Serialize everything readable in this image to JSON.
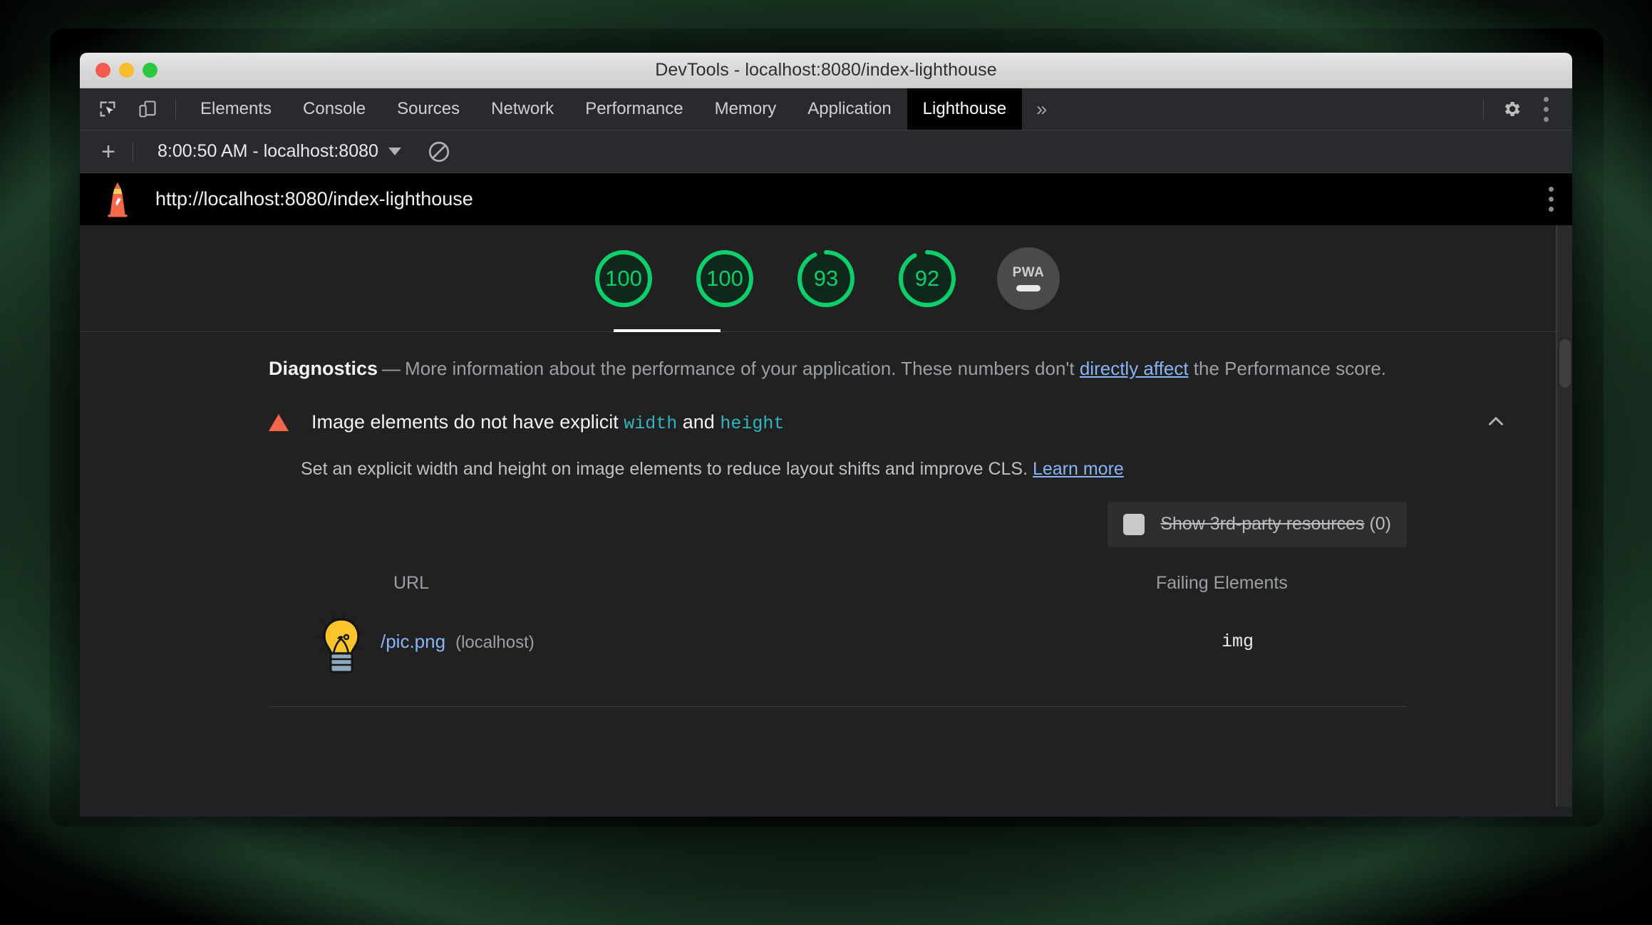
{
  "window": {
    "title": "DevTools - localhost:8080/index-lighthouse",
    "traffic_lights": [
      "close",
      "minimize",
      "maximize"
    ]
  },
  "devtools": {
    "tools": [
      {
        "name": "inspect-element-icon",
        "label": "Inspect element"
      },
      {
        "name": "device-toolbar-icon",
        "label": "Toggle device toolbar"
      }
    ],
    "tabs": [
      {
        "label": "Elements",
        "selected": false
      },
      {
        "label": "Console",
        "selected": false
      },
      {
        "label": "Sources",
        "selected": false
      },
      {
        "label": "Network",
        "selected": false
      },
      {
        "label": "Performance",
        "selected": false
      },
      {
        "label": "Memory",
        "selected": false
      },
      {
        "label": "Application",
        "selected": false
      },
      {
        "label": "Lighthouse",
        "selected": true
      }
    ],
    "more_tabs_label": "»",
    "settings_icon": "gear-icon",
    "menu_icon": "kebab-menu-icon"
  },
  "lighthouse_toolbar": {
    "add_label": "+",
    "run_selector_value": "8:00:50 AM - localhost:8080",
    "clear_icon": "clear-all-icon"
  },
  "report_header": {
    "logo_icon": "lighthouse-logo-icon",
    "url": "http://localhost:8080/index-lighthouse",
    "menu_icon": "kebab-menu-icon"
  },
  "scores": {
    "gauges": [
      {
        "value": "100",
        "pct": 100,
        "color": "#0cce6b",
        "selected": true
      },
      {
        "value": "100",
        "pct": 100,
        "color": "#0cce6b",
        "selected": false
      },
      {
        "value": "93",
        "pct": 93,
        "color": "#0cce6b",
        "selected": false
      },
      {
        "value": "92",
        "pct": 92,
        "color": "#0cce6b",
        "selected": false
      }
    ],
    "pwa": {
      "label": "PWA",
      "state": "dash"
    }
  },
  "diagnostics": {
    "heading": "Diagnostics",
    "dash": "—",
    "text_before_link": "More information about the performance of your application. These numbers don't ",
    "link_text": "directly affect",
    "text_after_link": " the Performance score."
  },
  "audit": {
    "warning_icon": "warning-triangle-icon",
    "title_part1": "Image elements do not have explicit ",
    "title_code1": "width",
    "title_part2": " and ",
    "title_code2": "height",
    "chevron_icon": "chevron-up-icon",
    "description_before_link": "Set an explicit width and height on image elements to reduce layout shifts and improve CLS. ",
    "description_link": "Learn more"
  },
  "filter": {
    "checkbox_state": "unchecked",
    "label_struck": "Show 3rd-party resources",
    "label_count": " (0)"
  },
  "table": {
    "columns": [
      "URL",
      "Failing Elements"
    ],
    "rows": [
      {
        "thumbnail_icon": "lightbulb-image-thumbnail",
        "url": "/pic.png",
        "host": "(localhost)",
        "failing_element": "img"
      }
    ]
  },
  "scrollbar": {
    "name": "report-vertical-scrollbar"
  },
  "colors": {
    "accent_green": "#0cce6b",
    "link_blue": "#8ab4f8",
    "warn_orange": "#f4654e",
    "code_teal": "#2eb6c2",
    "window_chrome": "#292a2d",
    "report_bg": "#212121"
  }
}
